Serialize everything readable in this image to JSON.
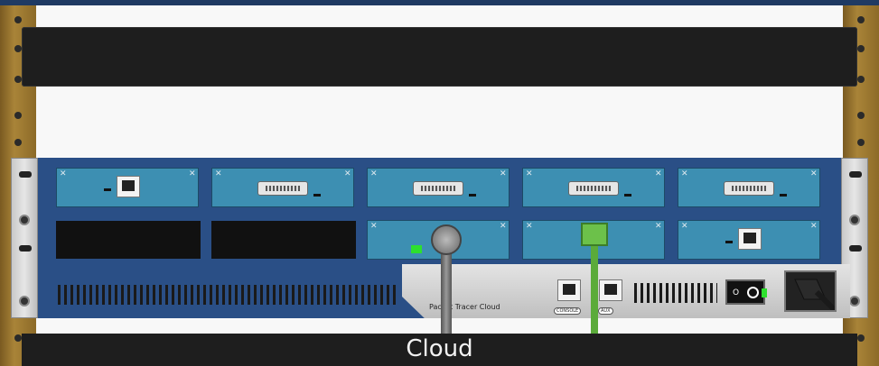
{
  "device": {
    "name": "Cloud",
    "panel_label": "Packet Tracer Cloud",
    "console_label": "CONSOLE",
    "aux_label": "AUX"
  },
  "modules": [
    {
      "row": 1,
      "slot": 1,
      "type": "rj45"
    },
    {
      "row": 1,
      "slot": 2,
      "type": "serial"
    },
    {
      "row": 1,
      "slot": 3,
      "type": "serial"
    },
    {
      "row": 1,
      "slot": 4,
      "type": "serial"
    },
    {
      "row": 1,
      "slot": 5,
      "type": "serial"
    },
    {
      "row": 2,
      "slot": 1,
      "type": "empty"
    },
    {
      "row": 2,
      "slot": 2,
      "type": "empty"
    },
    {
      "row": 2,
      "slot": 3,
      "type": "coaxial"
    },
    {
      "row": 2,
      "slot": 4,
      "type": "rj45"
    },
    {
      "row": 2,
      "slot": 5,
      "type": "rj45"
    }
  ],
  "power_switch": {
    "off_label": "O"
  },
  "colors": {
    "chassis": "#2a4f86",
    "module": "#3d8fb2",
    "rail": "#a98438",
    "link_up": "#2de02d",
    "ethernet_cable": "#5bab3a"
  }
}
